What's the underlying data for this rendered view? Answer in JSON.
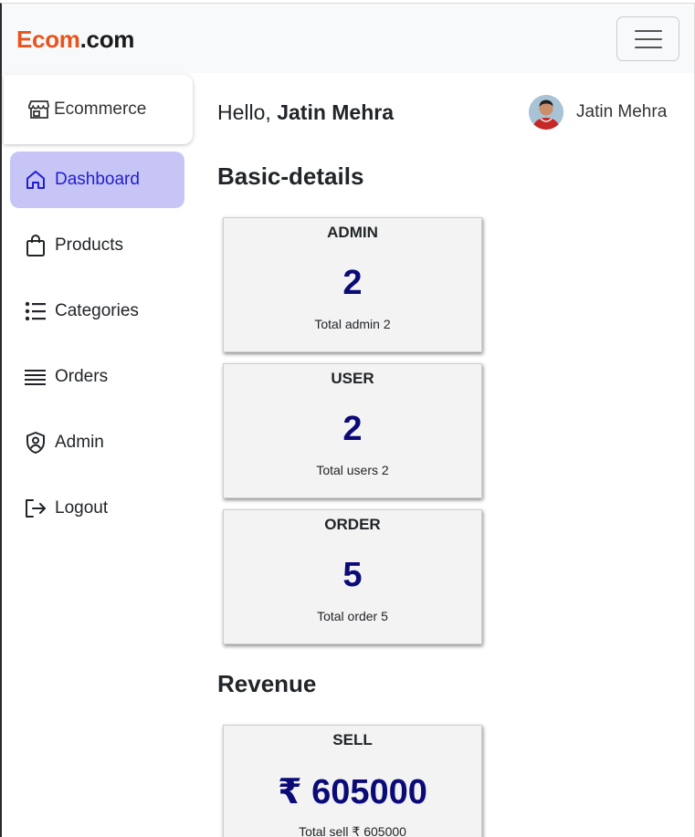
{
  "navbar": {
    "brand_part1": "Ecom",
    "brand_part2": ".com",
    "menu_icon": "hamburger-menu-icon"
  },
  "sidebar": {
    "store_label": "Ecommerce",
    "store_icon": "storefront-icon",
    "items": [
      {
        "label": "Dashboard",
        "icon": "home-icon",
        "active": true
      },
      {
        "label": "Products",
        "icon": "shopping-bag-icon",
        "active": false
      },
      {
        "label": "Categories",
        "icon": "list-icon",
        "active": false
      },
      {
        "label": "Orders",
        "icon": "lines-icon",
        "active": false
      },
      {
        "label": "Admin",
        "icon": "shield-user-icon",
        "active": false
      },
      {
        "label": "Logout",
        "icon": "logout-icon",
        "active": false
      }
    ]
  },
  "header": {
    "greeting_prefix": "Hello, ",
    "user_name": "Jatin Mehra",
    "chip_name": "Jatin Mehra"
  },
  "basic_details": {
    "title": "Basic-details",
    "cards": [
      {
        "label": "ADMIN",
        "value": "2",
        "caption": "Total admin 2"
      },
      {
        "label": "USER",
        "value": "2",
        "caption": "Total users 2"
      },
      {
        "label": "ORDER",
        "value": "5",
        "caption": "Total order 5"
      }
    ]
  },
  "revenue": {
    "title": "Revenue",
    "cards": [
      {
        "label": "SELL",
        "value": "₹ 605000",
        "caption": "Total sell ₹ 605000"
      }
    ]
  },
  "colors": {
    "brand_accent": "#e8541e",
    "active_nav_bg": "#c7c5f6",
    "active_nav_text": "#1f1fd0",
    "stat_value": "#0b0b78"
  }
}
